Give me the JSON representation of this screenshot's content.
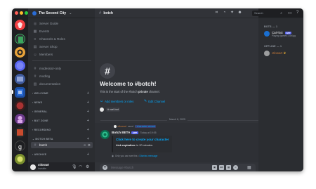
{
  "guild": {
    "name": "The Second City"
  },
  "channel": {
    "name": "botch"
  },
  "search": {
    "placeholder": "Search"
  },
  "sidebar": {
    "top_items": [
      {
        "label": "Server Guide",
        "icon": "compass-icon"
      },
      {
        "label": "Events",
        "icon": "calendar-icon"
      },
      {
        "label": "Channels & Roles",
        "icon": "list-icon"
      },
      {
        "label": "Server Shop",
        "icon": "shop-icon"
      },
      {
        "label": "Members",
        "icon": "members-icon"
      }
    ],
    "channels": [
      {
        "label": "moderator-only"
      },
      {
        "label": "modlog"
      },
      {
        "label": "documentation"
      }
    ],
    "categories": [
      "WELCOME",
      "NEWS",
      "GENERAL",
      "BOT ZONE",
      "RECORDING",
      "BOTCH BETA",
      "ARCHIVE"
    ],
    "active_channel": "botch"
  },
  "user": {
    "name": "ctlowart",
    "status": "Invisible"
  },
  "welcome": {
    "title": "Welcome to #botch!",
    "sub_prefix": "This is the start of the #botch ",
    "sub_bold": "private",
    "sub_suffix": " channel.",
    "add_members": "Add members or roles",
    "edit_channel": "Edit Channel",
    "member_pill": "# carl-bot"
  },
  "date_divider": "March 6, 2025",
  "message": {
    "reply_user": "ctlowart",
    "reply_used": "used",
    "reply_command": "/ character wizard",
    "author": "Botch BETA",
    "author_tag": "APP",
    "timestamp": "Today at 19:05",
    "embed_link": "Click here to create your character",
    "embed_field_label": "Link expiration:",
    "embed_field_value": "in 20 minutes.",
    "ephemeral_note": "Only you can see this •",
    "ephemeral_link": "Dismiss message"
  },
  "composer": {
    "placeholder": "Message #botch"
  },
  "members": {
    "groups": [
      {
        "title": "BOTS — 1",
        "items": [
          {
            "name": "Carl-bot",
            "tag": "APP",
            "status": "Playing /games | carl.gg",
            "color": "#f2f3f5"
          }
        ]
      },
      {
        "title": "OFFLINE — 1",
        "items": [
          {
            "name": "ctlowart",
            "tag": "",
            "status": "",
            "color": "#c97a38"
          }
        ]
      }
    ]
  },
  "colors": {
    "accent": "#5865f2",
    "link": "#00a8fc",
    "bg": "#313338",
    "sidebar": "#2b2d31",
    "rail": "#1e1f22"
  }
}
